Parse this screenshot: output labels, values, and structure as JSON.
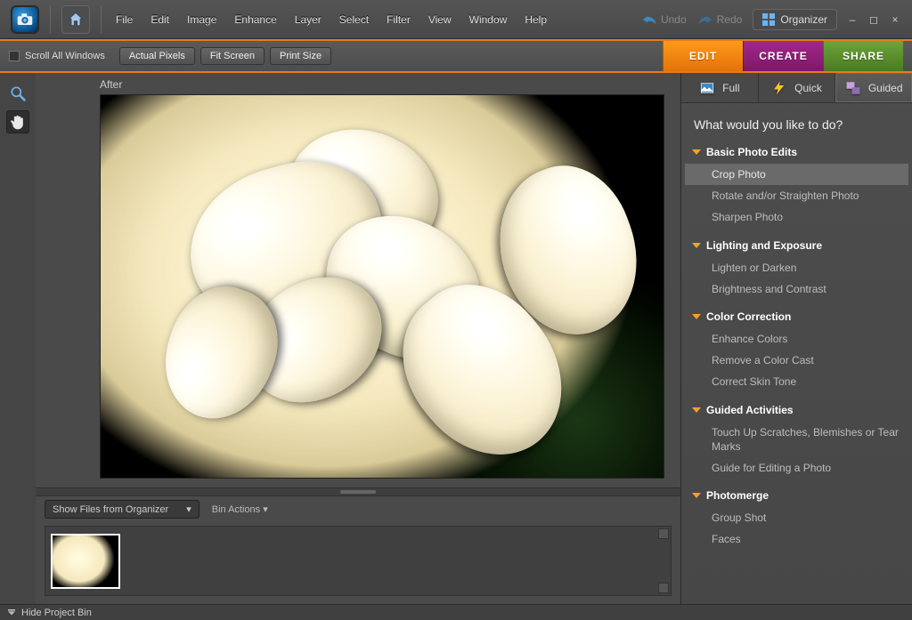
{
  "menubar": {
    "items": [
      "File",
      "Edit",
      "Image",
      "Enhance",
      "Layer",
      "Select",
      "Filter",
      "View",
      "Window",
      "Help"
    ],
    "undo": "Undo",
    "redo": "Redo",
    "organizer": "Organizer"
  },
  "optionsbar": {
    "scroll_all": "Scroll All Windows",
    "buttons": [
      "Actual Pixels",
      "Fit Screen",
      "Print Size"
    ]
  },
  "mode_tabs": {
    "edit": "EDIT",
    "create": "CREATE",
    "share": "SHARE"
  },
  "subtabs": {
    "full": "Full",
    "quick": "Quick",
    "guided": "Guided"
  },
  "canvas": {
    "label": "After"
  },
  "panel": {
    "question": "What would you like to do?",
    "sections": [
      {
        "title": "Basic Photo Edits",
        "items": [
          "Crop Photo",
          "Rotate and/or Straighten Photo",
          "Sharpen Photo"
        ],
        "selected": 0
      },
      {
        "title": "Lighting and Exposure",
        "items": [
          "Lighten or Darken",
          "Brightness and Contrast"
        ]
      },
      {
        "title": "Color Correction",
        "items": [
          "Enhance Colors",
          "Remove a Color Cast",
          "Correct Skin Tone"
        ]
      },
      {
        "title": "Guided Activities",
        "items": [
          "Touch Up Scratches, Blemishes or Tear Marks",
          "Guide for Editing a Photo"
        ]
      },
      {
        "title": "Photomerge",
        "items": [
          "Group Shot",
          "Faces"
        ]
      }
    ]
  },
  "bin": {
    "dd_label": "Show Files from Organizer",
    "actions": "Bin Actions"
  },
  "statusbar": {
    "hide_bin": "Hide Project Bin"
  }
}
